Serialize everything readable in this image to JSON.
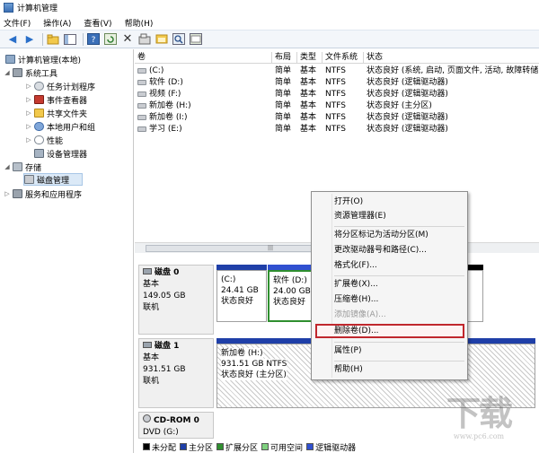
{
  "window": {
    "title": "计算机管理"
  },
  "menu": [
    "文件(F)",
    "操作(A)",
    "查看(V)",
    "帮助(H)"
  ],
  "toolbar": [
    "back-icon",
    "forward-icon",
    "up-icon",
    "show-hide-icon",
    "help-icon",
    "refresh-icon",
    "delete-icon",
    "properties-icon",
    "open-icon",
    "search-icon",
    "export-icon"
  ],
  "tree": {
    "root": "计算机管理(本地)",
    "system_tools": "系统工具",
    "task_scheduler": "任务计划程序",
    "event_viewer": "事件查看器",
    "shared_folders": "共享文件夹",
    "local_users": "本地用户和组",
    "performance": "性能",
    "device_manager": "设备管理器",
    "storage": "存储",
    "disk_management": "磁盘管理",
    "services_apps": "服务和应用程序"
  },
  "volumes": {
    "headers": [
      "卷",
      "布局",
      "类型",
      "文件系统",
      "状态"
    ],
    "rows": [
      [
        "(C:)",
        "简单",
        "基本",
        "NTFS",
        "状态良好 (系统, 启动, 页面文件, 活动, 故障转储"
      ],
      [
        "软件 (D:)",
        "简单",
        "基本",
        "NTFS",
        "状态良好 (逻辑驱动器)"
      ],
      [
        "视频 (F:)",
        "简单",
        "基本",
        "NTFS",
        "状态良好 (逻辑驱动器)"
      ],
      [
        "新加卷 (H:)",
        "简单",
        "基本",
        "NTFS",
        "状态良好 (主分区)"
      ],
      [
        "新加卷 (I:)",
        "简单",
        "基本",
        "NTFS",
        "状态良好 (逻辑驱动器)"
      ],
      [
        "学习 (E:)",
        "简单",
        "基本",
        "NTFS",
        "状态良好 (逻辑驱动器)"
      ]
    ]
  },
  "disks": {
    "disk0": {
      "name": "磁盘 0",
      "type": "基本",
      "size": "149.05 GB",
      "status": "联机",
      "p1": {
        "label": "(C:)",
        "size": "24.41 GB",
        "status": "状态良好"
      },
      "p2": {
        "label": "软件 (D:)",
        "size": "24.00 GB",
        "status": "状态良好"
      }
    },
    "disk1": {
      "name": "磁盘 1",
      "type": "基本",
      "size": "931.51 GB",
      "status": "联机",
      "p1": {
        "label": "新加卷 (H:)",
        "size": "931.51 GB NTFS",
        "status": "状态良好 (主分区)"
      }
    },
    "cdrom": {
      "name": "CD-ROM 0",
      "drive": "DVD (G:)"
    }
  },
  "legend": [
    {
      "label": "未分配",
      "color": "#000000"
    },
    {
      "label": "主分区",
      "color": "#1f3fa8"
    },
    {
      "label": "扩展分区",
      "color": "#2f8f2f"
    },
    {
      "label": "可用空间",
      "color": "#7fd17f"
    },
    {
      "label": "逻辑驱动器",
      "color": "#3050d0"
    }
  ],
  "context_menu": {
    "open": "打开(O)",
    "explorer": "资源管理器(E)",
    "mark_active": "将分区标记为活动分区(M)",
    "change_letter": "更改驱动器号和路径(C)...",
    "format": "格式化(F)...",
    "extend": "扩展卷(X)...",
    "shrink": "压缩卷(H)...",
    "add_mirror": "添加镜像(A)...",
    "delete": "删除卷(D)...",
    "properties": "属性(P)",
    "help": "帮助(H)"
  },
  "watermark": {
    "big": "下载",
    "small": "www.pc6.com"
  }
}
